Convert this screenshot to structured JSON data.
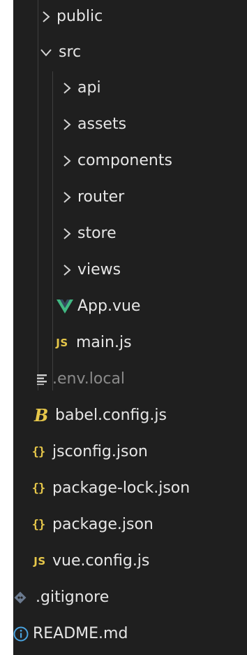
{
  "explorer": {
    "items": [
      {
        "label": "public",
        "kind": "folder",
        "expanded": false,
        "depth": 1
      },
      {
        "label": "src",
        "kind": "folder",
        "expanded": true,
        "depth": 1
      },
      {
        "label": "api",
        "kind": "folder",
        "expanded": false,
        "depth": 2
      },
      {
        "label": "assets",
        "kind": "folder",
        "expanded": false,
        "depth": 2
      },
      {
        "label": "components",
        "kind": "folder",
        "expanded": false,
        "depth": 2
      },
      {
        "label": "router",
        "kind": "folder",
        "expanded": false,
        "depth": 2
      },
      {
        "label": "store",
        "kind": "folder",
        "expanded": false,
        "depth": 2
      },
      {
        "label": "views",
        "kind": "folder",
        "expanded": false,
        "depth": 2
      },
      {
        "label": "App.vue",
        "kind": "vue",
        "depth": 2
      },
      {
        "label": "main.js",
        "kind": "js",
        "depth": 2
      },
      {
        "label": ".env.local",
        "kind": "env",
        "depth": 1
      },
      {
        "label": "babel.config.js",
        "kind": "babel",
        "depth": 1
      },
      {
        "label": "jsconfig.json",
        "kind": "json",
        "depth": 1
      },
      {
        "label": "package-lock.json",
        "kind": "json",
        "depth": 1
      },
      {
        "label": "package.json",
        "kind": "json",
        "depth": 1
      },
      {
        "label": "vue.config.js",
        "kind": "js",
        "depth": 1
      },
      {
        "label": ".gitignore",
        "kind": "git",
        "depth": 0
      },
      {
        "label": "README.md",
        "kind": "info",
        "depth": 0
      }
    ],
    "icons": {
      "js": "JS",
      "json": "{}"
    },
    "colors": {
      "background": "#1f1f1f",
      "text": "#e6e6e6",
      "dim_text": "#8b8b8b",
      "vue_green": "#41b883",
      "js_yellow": "#e6c74a",
      "info_blue": "#4aa3df",
      "git_gray": "#6b7a8f"
    }
  }
}
